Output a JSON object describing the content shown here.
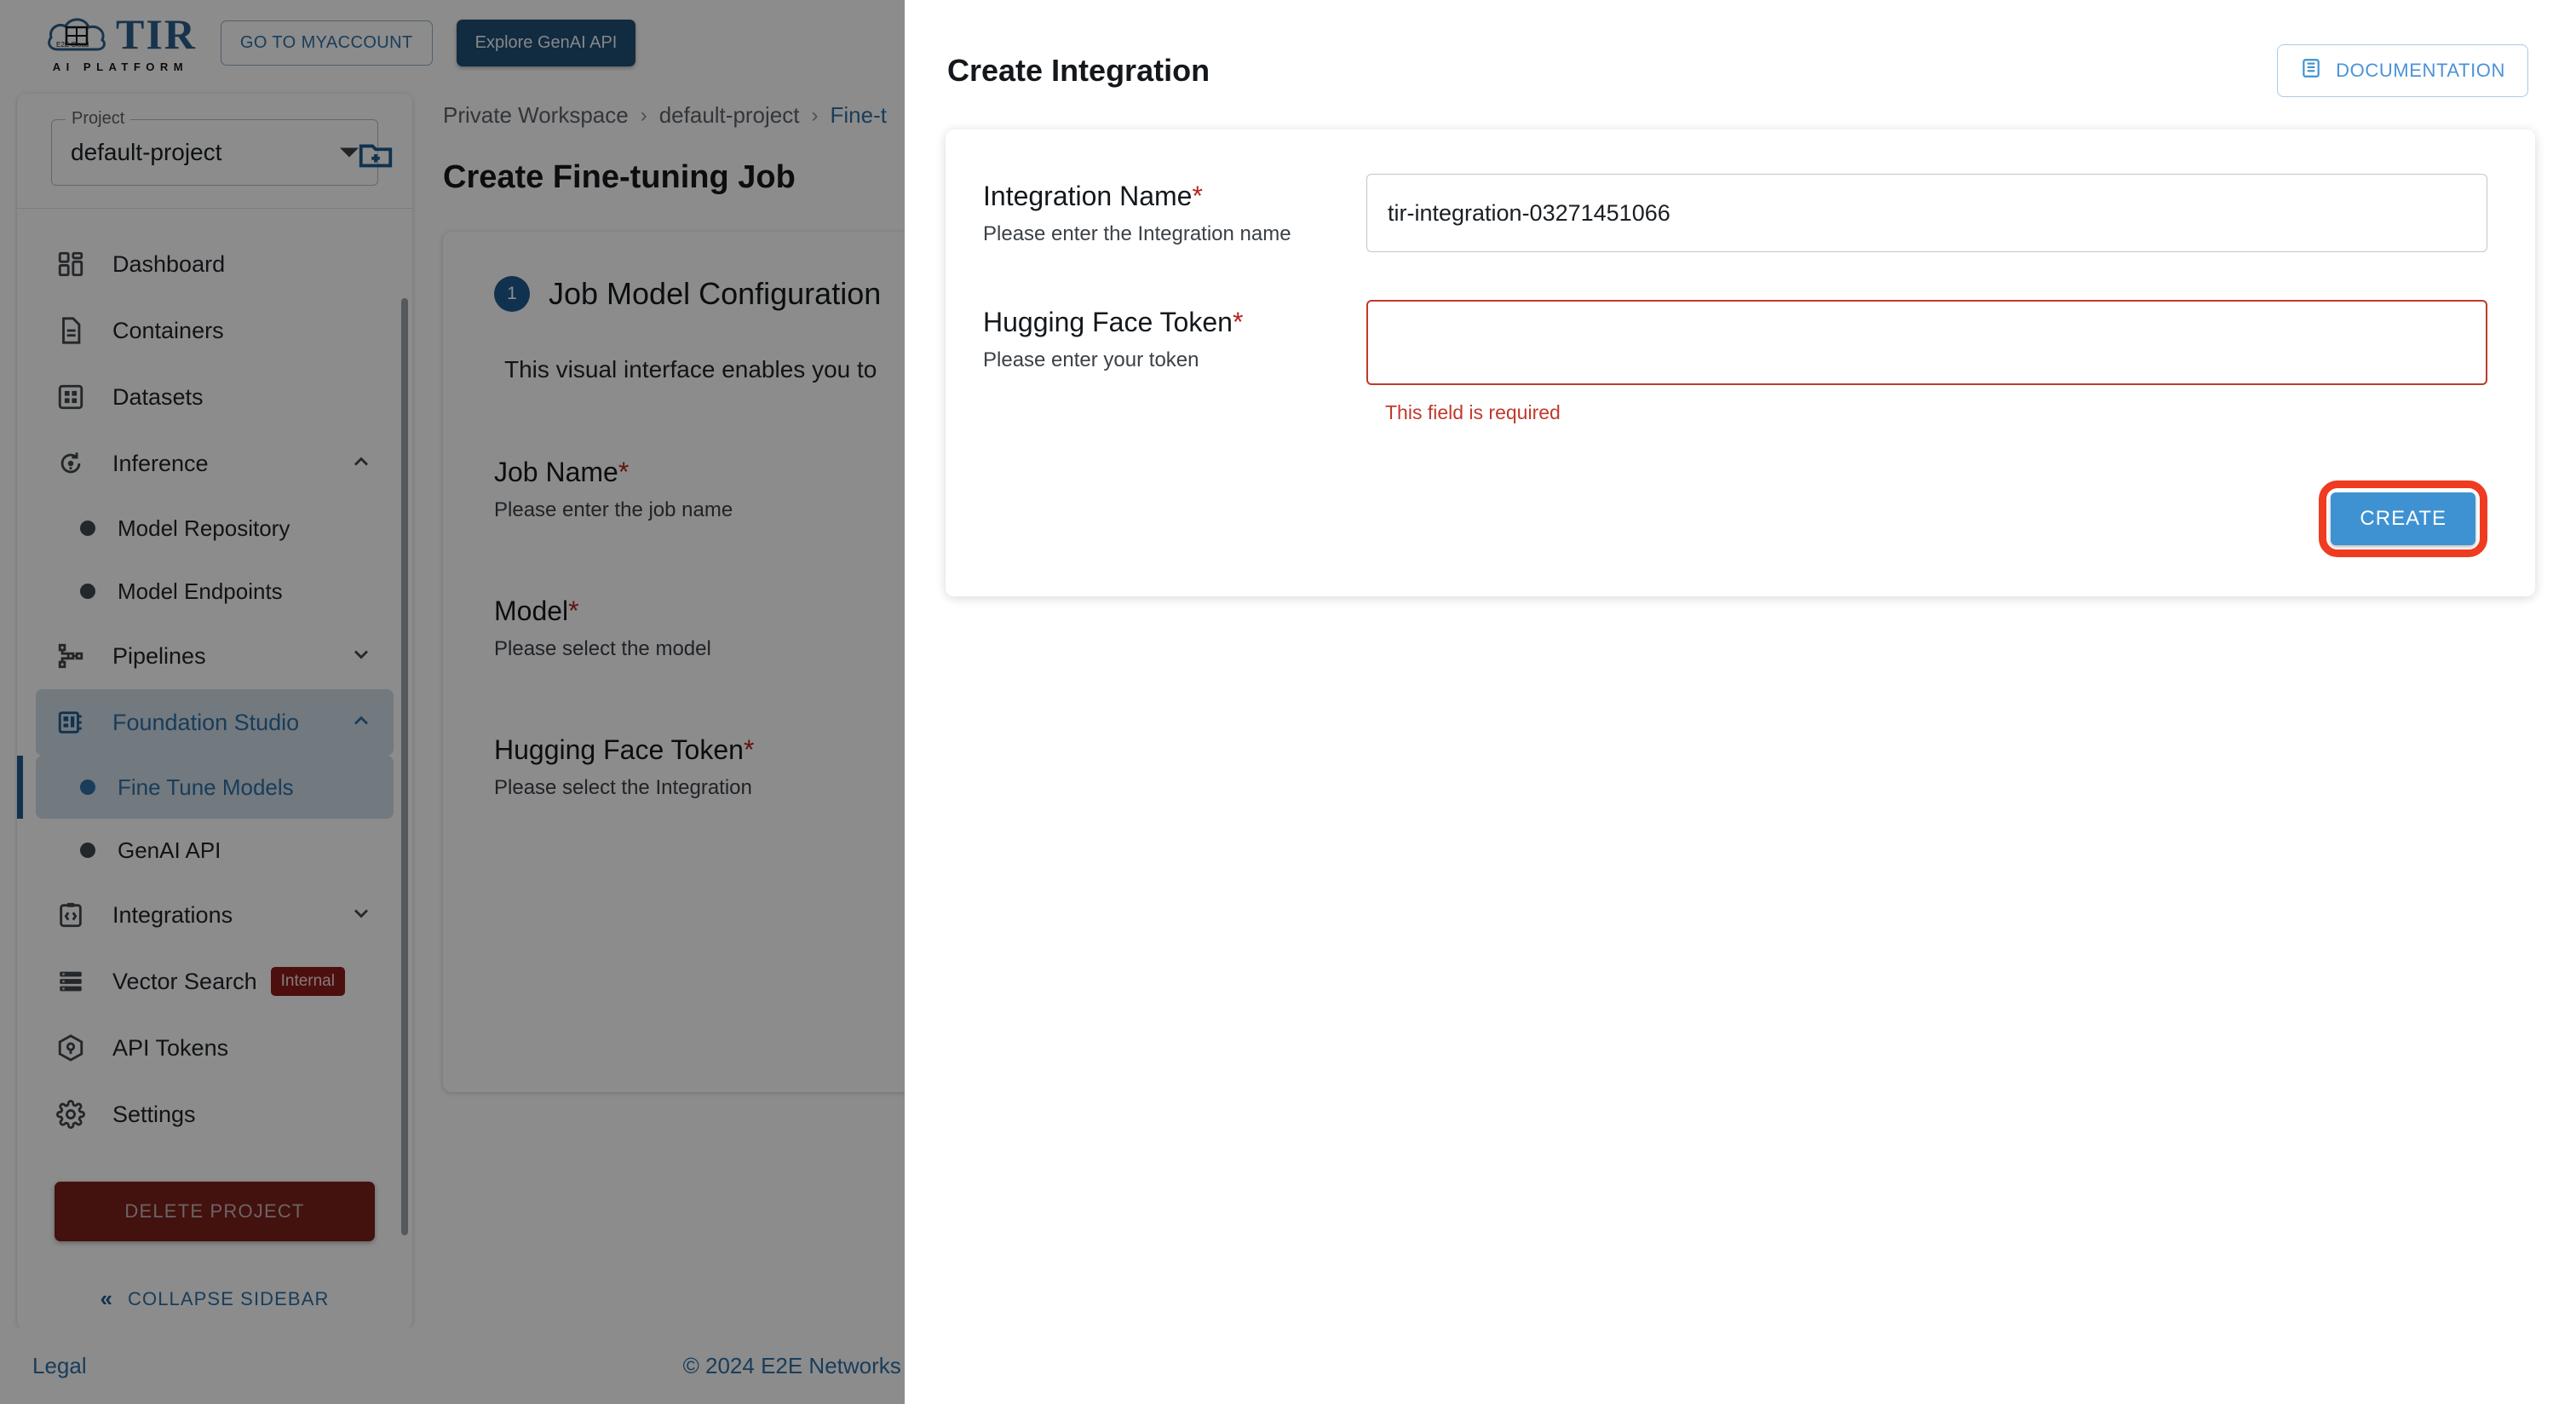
{
  "header": {
    "brand_name": "TIR",
    "brand_tagline": "AI PLATFORM",
    "brand_cloud_label": "E2E Cloud",
    "myaccount_label": "GO TO MYACCOUNT",
    "genai_label": "Explore GenAI API"
  },
  "sidebar": {
    "project_legend": "Project",
    "project_value": "default-project",
    "new_folder_icon": "new-folder-icon",
    "items": [
      {
        "label": "Dashboard",
        "icon": "dashboard-icon",
        "type": "item",
        "state": "normal",
        "chevron": ""
      },
      {
        "label": "Containers",
        "icon": "document-icon",
        "type": "item",
        "state": "normal",
        "chevron": ""
      },
      {
        "label": "Datasets",
        "icon": "grid-icon",
        "type": "item",
        "state": "normal",
        "chevron": ""
      },
      {
        "label": "Inference",
        "icon": "inference-icon",
        "type": "item",
        "state": "normal",
        "chevron": "up"
      },
      {
        "label": "Model Repository",
        "icon": "bullet-icon",
        "type": "sub",
        "state": "normal",
        "chevron": ""
      },
      {
        "label": "Model Endpoints",
        "icon": "bullet-icon",
        "type": "sub",
        "state": "normal",
        "chevron": ""
      },
      {
        "label": "Pipelines",
        "icon": "pipelines-icon",
        "type": "item",
        "state": "normal",
        "chevron": "down"
      },
      {
        "label": "Foundation Studio",
        "icon": "foundation-studio-icon",
        "type": "item",
        "state": "active",
        "chevron": "up"
      },
      {
        "label": "Fine Tune Models",
        "icon": "bullet-icon",
        "type": "sub",
        "state": "active",
        "chevron": ""
      },
      {
        "label": "GenAI API",
        "icon": "bullet-icon",
        "type": "sub",
        "state": "normal",
        "chevron": ""
      },
      {
        "label": "Integrations",
        "icon": "integrations-icon",
        "type": "item",
        "state": "normal",
        "chevron": "down"
      },
      {
        "label": "Vector Search",
        "icon": "vector-search-icon",
        "type": "item",
        "state": "normal",
        "chevron": "",
        "badge": "Internal"
      },
      {
        "label": "API Tokens",
        "icon": "api-tokens-icon",
        "type": "item",
        "state": "normal",
        "chevron": ""
      },
      {
        "label": "Settings",
        "icon": "gear-icon",
        "type": "item",
        "state": "normal",
        "chevron": ""
      }
    ],
    "delete_project_label": "DELETE PROJECT",
    "collapse_label": "COLLAPSE SIDEBAR",
    "collapse_icon": "chevron-double-left-icon"
  },
  "main": {
    "breadcrumb": {
      "workspace": "Private Workspace",
      "project": "default-project",
      "current": "Fine-t",
      "separator": "›"
    },
    "page_title": "Create Fine-tuning Job",
    "step": {
      "number": "1",
      "title": "Job Model Configuration"
    },
    "intro_text": "This visual interface enables you to",
    "fields": [
      {
        "label": "Job Name",
        "required": "*",
        "help": "Please enter the job name"
      },
      {
        "label": "Model",
        "required": "*",
        "help": "Please select the model"
      },
      {
        "label": "Hugging Face Token",
        "required": "*",
        "help": "Please select the Integration"
      }
    ]
  },
  "footer": {
    "legal": "Legal",
    "copyright": "© 2024 E2E Networks"
  },
  "modal": {
    "title": "Create Integration",
    "documentation_label": "DOCUMENTATION",
    "documentation_icon": "document-lines-icon",
    "fields": [
      {
        "label": "Integration Name",
        "required": "*",
        "help": "Please enter the Integration name",
        "value": "tir-integration-03271451066",
        "placeholder": "",
        "error": ""
      },
      {
        "label": "Hugging Face Token",
        "required": "*",
        "help": "Please enter your token",
        "value": "",
        "placeholder": "",
        "error": "This field is required"
      }
    ],
    "create_label": "CREATE"
  },
  "colors": {
    "brand_blue": "#2d5f8b",
    "accent_blue": "#2f6fa5",
    "create_button": "#3f92d2",
    "error_red": "#c0392b",
    "highlight_ring": "#ef3b20",
    "danger_button": "#7a1f1b",
    "badge_internal": "#8c1d18"
  }
}
